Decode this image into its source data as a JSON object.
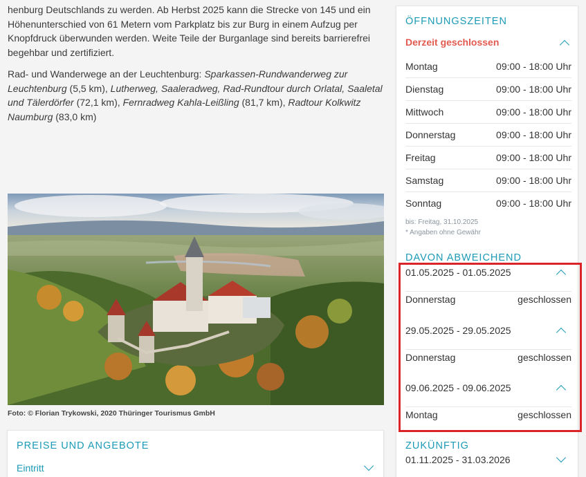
{
  "left": {
    "para1": "henburg Deutschlands zu werden. Ab Herbst 2025 kann die Strecke von 145 und ein Höhenunterschied von 61 Metern vom Parkplatz bis zur Burg in einem Aufzug per Knopfdruck überwunden werden. Weite Teile der Burganlage sind bereits barrierefrei begehbar und zertifiziert.",
    "para2_intro": "Rad- und Wanderwege an der Leuchtenburg: ",
    "route1": "Sparkassen-Rundwanderweg zur Leuchtenburg",
    "route1_dist": " (5,5 km), ",
    "route2": "Lutherweg, Saaleradweg, Rad-Rundtour durch Orlatal, Saaletal und Tälerdörfer",
    "route2_dist": " (72,1 km), ",
    "route3": "Fernradweg Kahla-Leißling",
    "route3_dist": " (81,7 km), ",
    "route4": "Radtour Kolkwitz Naumburg",
    "route4_dist": " (83,0 km)",
    "caption": "Foto: © Florian Trykowski, 2020 Thüringer Tourismus GmbH"
  },
  "prices": {
    "title": "PREISE UND ANGEBOTE",
    "entry": "Eintritt"
  },
  "hours": {
    "title": "ÖFFNUNGSZEITEN",
    "status": "Derzeit geschlossen",
    "days": [
      {
        "day": "Montag",
        "time": "09:00 - 18:00 Uhr"
      },
      {
        "day": "Dienstag",
        "time": "09:00 - 18:00 Uhr"
      },
      {
        "day": "Mittwoch",
        "time": "09:00 - 18:00 Uhr"
      },
      {
        "day": "Donnerstag",
        "time": "09:00 - 18:00 Uhr"
      },
      {
        "day": "Freitag",
        "time": "09:00 - 18:00 Uhr"
      },
      {
        "day": "Samstag",
        "time": "09:00 - 18:00 Uhr"
      },
      {
        "day": "Sonntag",
        "time": "09:00 - 18:00 Uhr"
      }
    ],
    "until": "bis: Freitag, 31.10.2025",
    "disclaimer": "* Angaben ohne Gewähr",
    "deviating_title": "DAVON ABWEICHEND",
    "deviations": [
      {
        "range": "01.05.2025 - 01.05.2025",
        "day": "Donnerstag",
        "status": "geschlossen"
      },
      {
        "range": "29.05.2025 - 29.05.2025",
        "day": "Donnerstag",
        "status": "geschlossen"
      },
      {
        "range": "09.06.2025 - 09.06.2025",
        "day": "Montag",
        "status": "geschlossen"
      }
    ],
    "future_title": "ZUKÜNFTIG",
    "future_range": "01.11.2025 - 31.03.2026"
  },
  "colors": {
    "accent": "#1b9ab6",
    "closed": "#e25a4f",
    "highlight": "#d9252a"
  }
}
